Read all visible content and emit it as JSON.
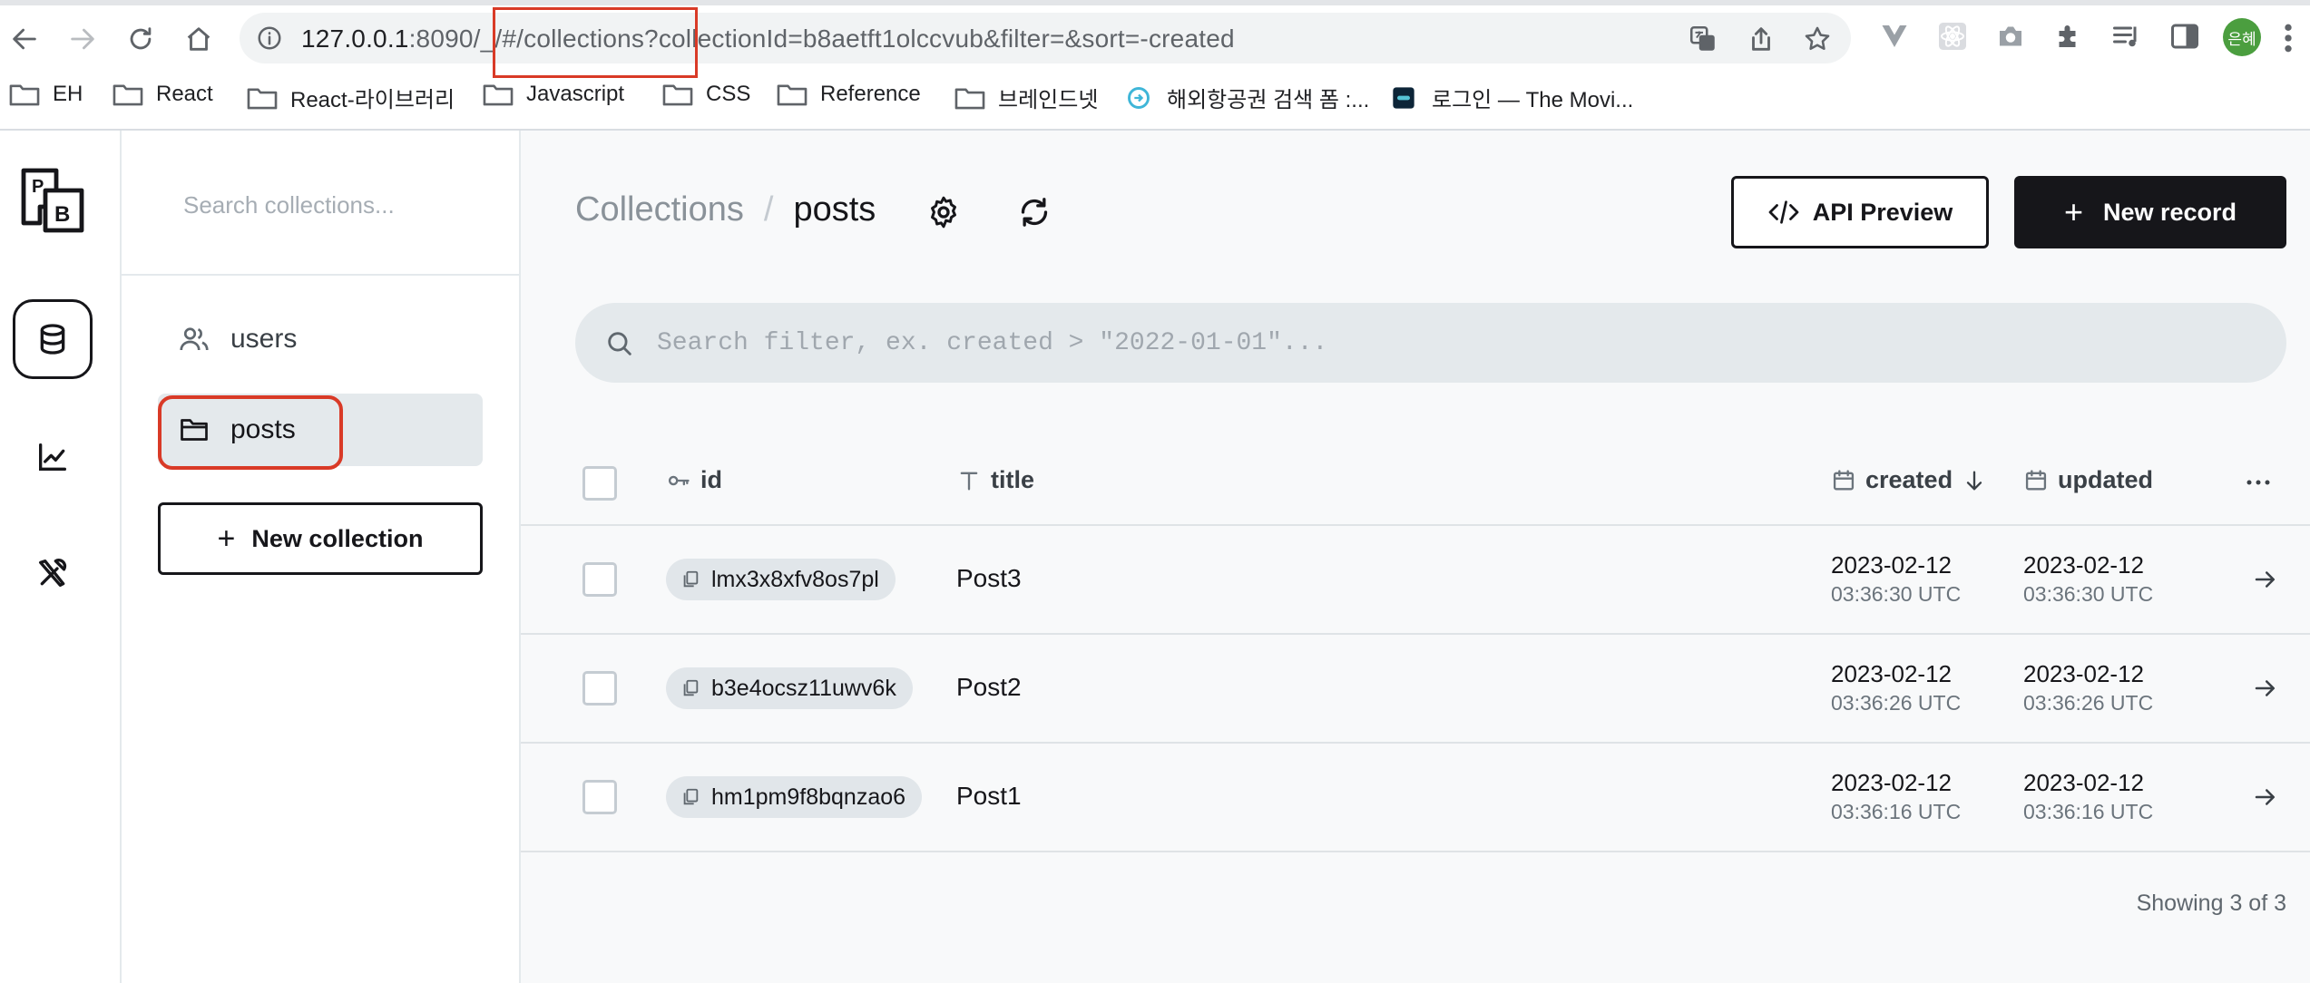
{
  "browser": {
    "url_host": "127.0.0.1",
    "url_rest": ":8090/_/#/collections?collectionId=b8aetft1olccvub&filter=&sort=-created",
    "avatar_text": "은혜",
    "bookmarks": [
      {
        "label": "EH",
        "icon": "folder-icon"
      },
      {
        "label": "React",
        "icon": "folder-icon"
      },
      {
        "label": "React-라이브러리",
        "icon": "folder-icon"
      },
      {
        "label": "Javascript",
        "icon": "folder-icon"
      },
      {
        "label": "CSS",
        "icon": "folder-icon"
      },
      {
        "label": "Reference",
        "icon": "folder-icon"
      },
      {
        "label": "브레인드넷",
        "icon": "folder-icon"
      },
      {
        "label": "해외항공권 검색 폼 :...",
        "icon": "site-icon"
      },
      {
        "label": "로그인 — The Movi...",
        "icon": "site-icon"
      }
    ]
  },
  "sidebar": {
    "search_placeholder": "Search collections...",
    "collections": [
      {
        "label": "users",
        "icon": "users-icon"
      },
      {
        "label": "posts",
        "icon": "folder-icon"
      }
    ],
    "new_collection_label": "New collection"
  },
  "header": {
    "breadcrumb_root": "Collections",
    "breadcrumb_sep": "/",
    "breadcrumb_current": "posts",
    "api_preview_label": "API Preview",
    "new_record_label": "New record"
  },
  "filter": {
    "placeholder": "Search filter, ex. created > \"2022-01-01\"..."
  },
  "table": {
    "columns": {
      "id": "id",
      "title": "title",
      "created": "created",
      "updated": "updated"
    },
    "rows": [
      {
        "id": "lmx3x8xfv8os7pl",
        "title": "Post3",
        "created_date": "2023-02-12",
        "created_time": "03:36:30 UTC",
        "updated_date": "2023-02-12",
        "updated_time": "03:36:30 UTC"
      },
      {
        "id": "b3e4ocsz11uwv6k",
        "title": "Post2",
        "created_date": "2023-02-12",
        "created_time": "03:36:26 UTC",
        "updated_date": "2023-02-12",
        "updated_time": "03:36:26 UTC"
      },
      {
        "id": "hm1pm9f8bqnzao6",
        "title": "Post1",
        "created_date": "2023-02-12",
        "created_time": "03:36:16 UTC",
        "updated_date": "2023-02-12",
        "updated_time": "03:36:16 UTC"
      }
    ],
    "footer": "Showing 3 of 3"
  },
  "colors": {
    "accent_dark": "#16161a",
    "highlight_red": "#d93a27",
    "chip_bg": "#e1e6ea"
  }
}
